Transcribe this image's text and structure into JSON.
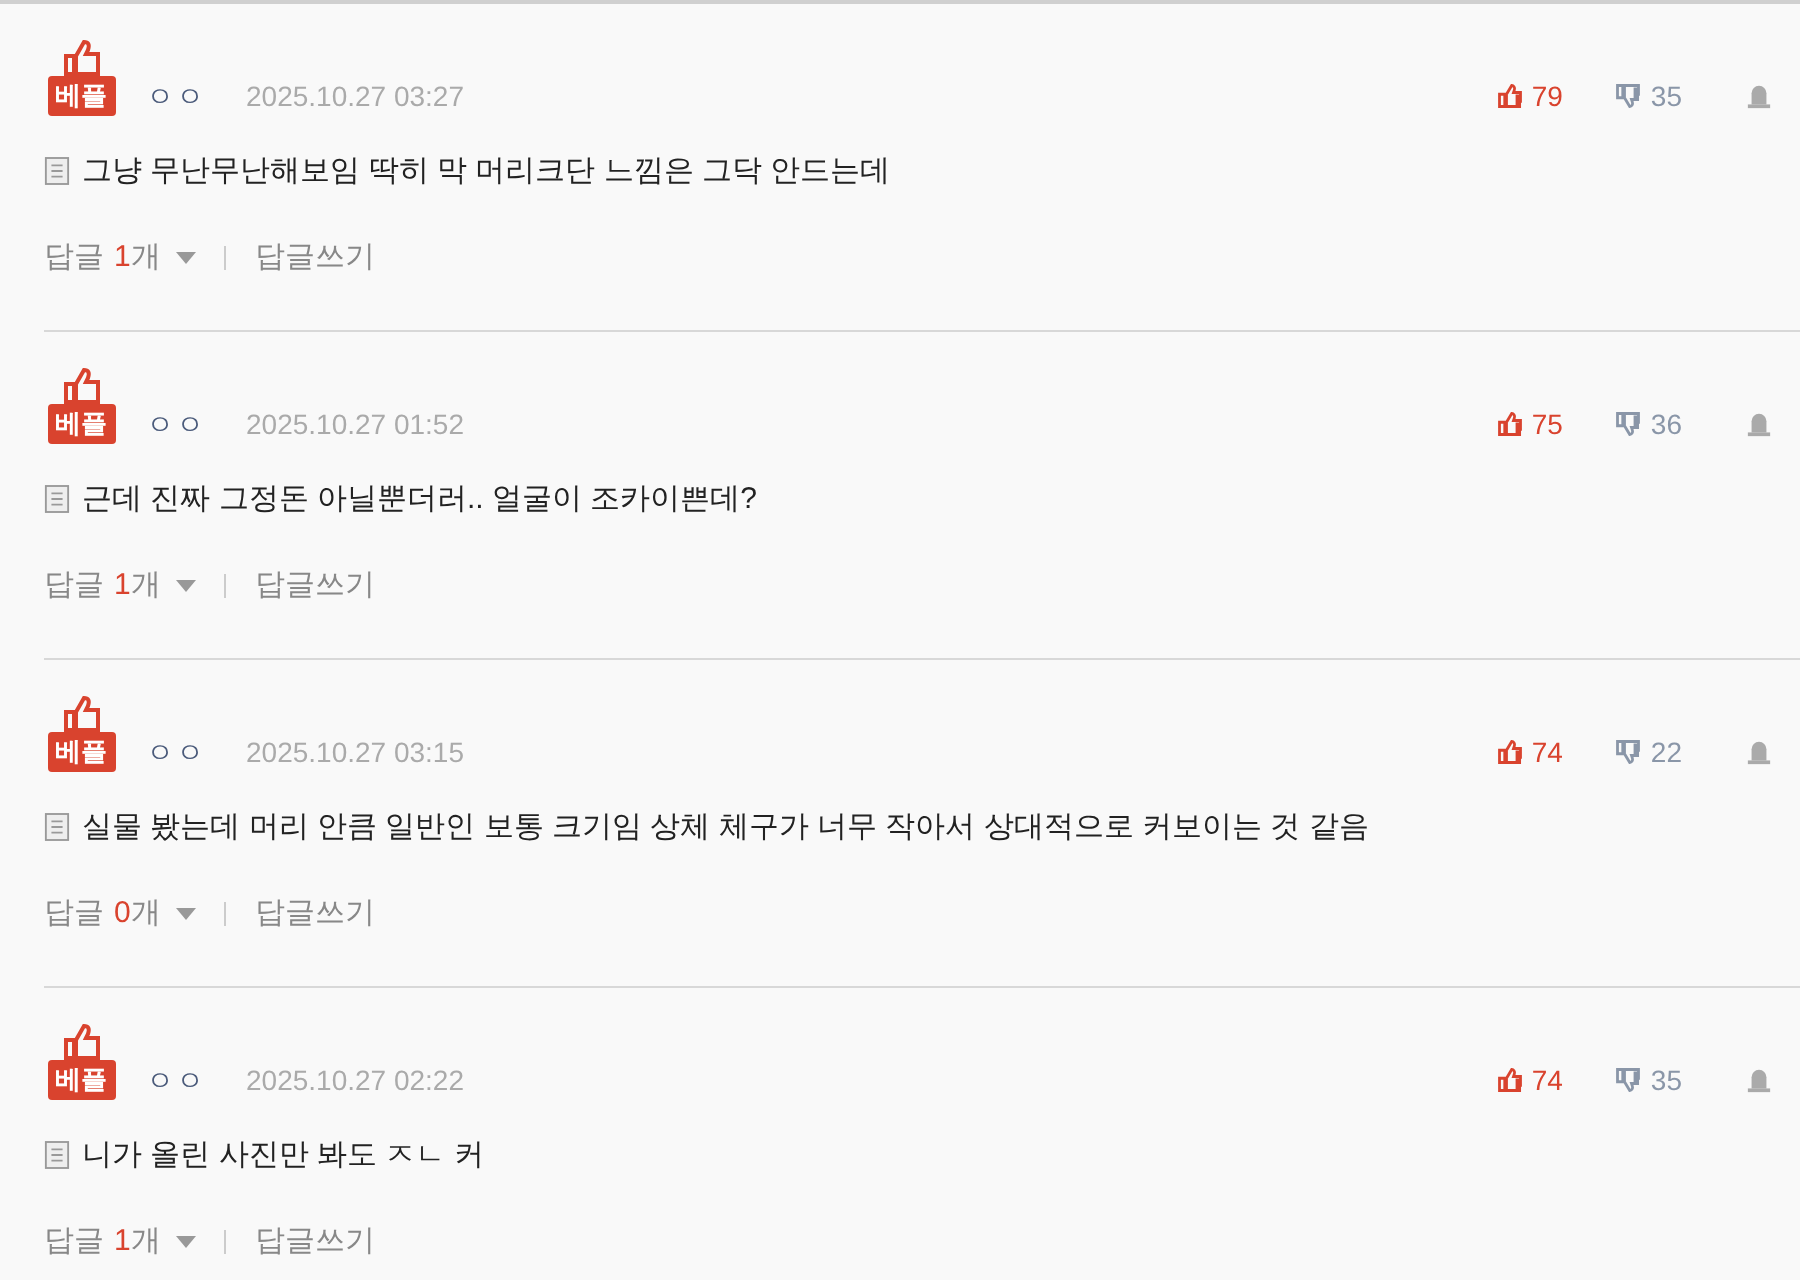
{
  "comments": [
    {
      "badge": "베플",
      "author": "ㅇㅇ",
      "date": "2025.10.27 03:27",
      "likes": "79",
      "dislikes": "35",
      "text": "그냥 무난무난해보임 딱히 막 머리크단 느낌은 그닥 안드는데",
      "reply_prefix": "답글",
      "reply_count": "1",
      "reply_suffix": "개",
      "write_reply": "답글쓰기"
    },
    {
      "badge": "베플",
      "author": "ㅇㅇ",
      "date": "2025.10.27 01:52",
      "likes": "75",
      "dislikes": "36",
      "text": "근데 진짜 그정돈 아닐뿐더러.. 얼굴이 조카이쁜데?",
      "reply_prefix": "답글",
      "reply_count": "1",
      "reply_suffix": "개",
      "write_reply": "답글쓰기"
    },
    {
      "badge": "베플",
      "author": "ㅇㅇ",
      "date": "2025.10.27 03:15",
      "likes": "74",
      "dislikes": "22",
      "text": "실물 봤는데 머리 안큼 일반인 보통 크기임 상체 체구가 너무 작아서 상대적으로 커보이는 것 같음",
      "reply_prefix": "답글",
      "reply_count": "0",
      "reply_suffix": "개",
      "write_reply": "답글쓰기"
    },
    {
      "badge": "베플",
      "author": "ㅇㅇ",
      "date": "2025.10.27 02:22",
      "likes": "74",
      "dislikes": "35",
      "text": "니가 올린 사진만 봐도 ㅈㄴ 커",
      "reply_prefix": "답글",
      "reply_count": "1",
      "reply_suffix": "개",
      "write_reply": "답글쓰기"
    }
  ]
}
